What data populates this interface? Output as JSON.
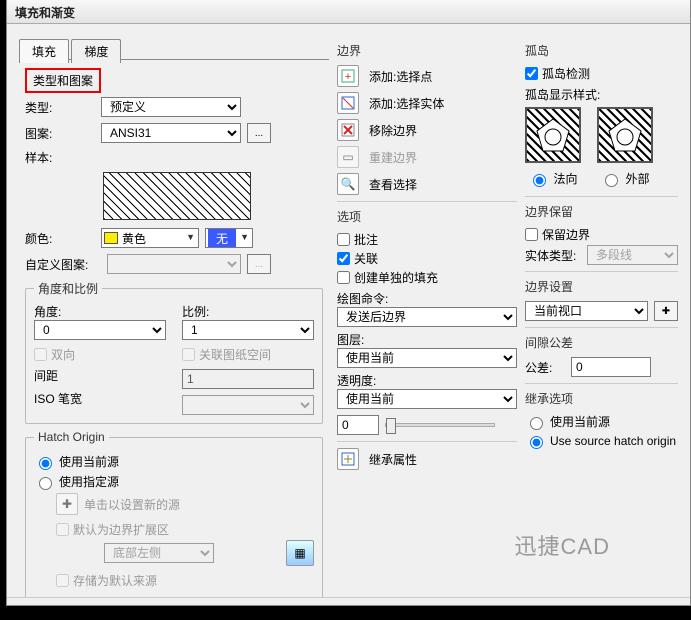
{
  "window": {
    "title": "填充和渐变"
  },
  "tabs": {
    "fill": "填充",
    "grad": "梯度"
  },
  "typeGroup": {
    "heading": "类型和图案",
    "typeLabel": "类型:",
    "typeValue": "预定义",
    "patternLabel": "图案:",
    "patternValue": "ANSI31",
    "sampleLabel": "样本:",
    "colorLabel": "颜色:",
    "colorValue": "黄色",
    "noneLabel": "无",
    "customLabel": "自定义图案:",
    "ellipsis": "..."
  },
  "angleScale": {
    "legend": "角度和比例",
    "angleLabel": "角度:",
    "angleValue": "0",
    "scaleLabel": "比例:",
    "scaleValue": "1",
    "bidir": "双向",
    "paperSpace": "关联图纸空间",
    "spacingLabel": "间距",
    "spacingValue": "1",
    "isoLabel": "ISO 笔宽"
  },
  "hatchOrigin": {
    "legend": "Hatch Origin",
    "useCurrentSource": "使用当前源",
    "useSpecifiedSource": "使用指定源",
    "hint": "单击以设置新的源",
    "defaultExtents": "默认为边界扩展区",
    "cornerValue": "底部左侧",
    "storeDefault": "存储为默认来源"
  },
  "boundary": {
    "heading": "边界",
    "addPick": "添加:选择点",
    "addSelect": "添加:选择实体",
    "removeBoundary": "移除边界",
    "rebuildBoundary": "重建边界",
    "viewSelection": "查看选择"
  },
  "options": {
    "heading": "选项",
    "annotate": "批注",
    "associative": "关联",
    "createSeparate": "创建单独的填充",
    "drawOrderLabel": "绘图命令:",
    "drawOrderValue": "发送后边界",
    "layerLabel": "图层:",
    "layerValue": "使用当前",
    "transparencyLabel": "透明度:",
    "transparencyValue": "使用当前",
    "transparencyNum": "0",
    "inherit": "继承属性"
  },
  "islands": {
    "heading": "孤岛",
    "detect": "孤岛检测",
    "styleLabel": "孤岛显示样式:",
    "normal": "法向",
    "outer": "外部"
  },
  "boundaryRetain": {
    "heading": "边界保留",
    "retain": "保留边界",
    "objectTypeLabel": "实体类型:",
    "objectTypeValue": "多段线"
  },
  "boundarySet": {
    "heading": "边界设置",
    "value": "当前视口"
  },
  "gap": {
    "heading": "间隙公差",
    "tolLabel": "公差:",
    "tolValue": "0"
  },
  "inheritOpts": {
    "heading": "继承选项",
    "useCurrentSource": "使用当前源",
    "useSourceOrigin": "Use source hatch origin"
  },
  "watermark": "迅捷CAD"
}
